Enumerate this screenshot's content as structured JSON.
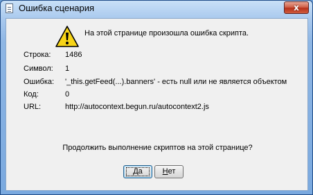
{
  "window": {
    "title": "Ошибка сценария",
    "close_glyph": "x"
  },
  "dialog": {
    "message": "На этой странице произошла ошибка скрипта.",
    "details": [
      {
        "label": "Строка:",
        "value": "1486"
      },
      {
        "label": "Символ:",
        "value": "1"
      },
      {
        "label": "Ошибка:",
        "value": "'_this.getFeed(...).banners' -  есть null или не является объектом"
      },
      {
        "label": "Код:",
        "value": "0"
      },
      {
        "label": "URL:",
        "value": "http://autocontext.begun.ru/autocontext2.js"
      }
    ],
    "question": "Продолжить выполнение скриптов на этой странице?"
  },
  "buttons": {
    "yes": {
      "mnemonic": "Д",
      "rest": "а"
    },
    "no": {
      "mnemonic": "Н",
      "rest": "ет"
    }
  },
  "icons": {
    "title": "script-document-icon",
    "warning": "warning-icon",
    "close": "close-icon"
  },
  "colors": {
    "warning_fill": "#f7d417",
    "close_button": "#c8452c",
    "titlebar": "#a9c9ee"
  }
}
